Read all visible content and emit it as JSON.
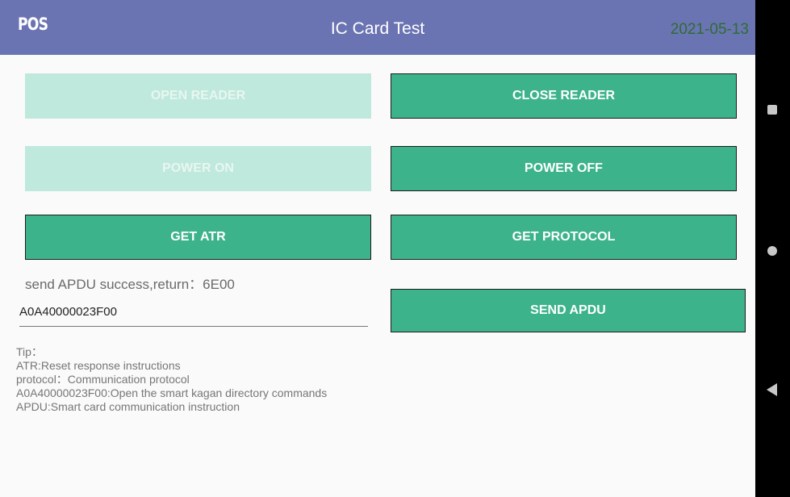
{
  "appbar": {
    "app_name": "POS",
    "title": "IC Card Test",
    "date": "2021-05-13"
  },
  "buttons": {
    "open_reader": "OPEN READER",
    "close_reader": "CLOSE READER",
    "power_on": "POWER ON",
    "power_off": "POWER OFF",
    "get_atr": "GET ATR",
    "get_protocol": "GET PROTOCOL",
    "send_apdu": "SEND APDU"
  },
  "status_text": "send APDU success,return：6E00",
  "apdu_input": {
    "value": "A0A40000023F00"
  },
  "tips": [
    "Tip：",
    "ATR:Reset response instructions",
    "protocol：Communication protocol",
    "A0A40000023F00:Open the smart kagan directory commands",
    "APDU:Smart card communication instruction"
  ],
  "nav_icons": [
    "recent-apps-icon",
    "home-icon",
    "back-icon"
  ],
  "colors": {
    "appbar": "#6b74b2",
    "button_enabled": "#3db38b",
    "button_disabled": "#bee9dc",
    "date": "#2e6c34"
  }
}
